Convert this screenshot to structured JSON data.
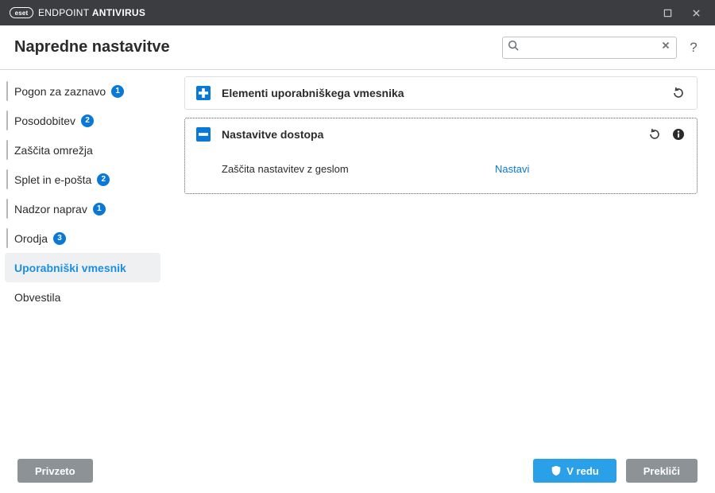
{
  "titlebar": {
    "brand_logo_text": "eset",
    "title_light": "ENDPOINT ",
    "title_bold": "ANTIVIRUS"
  },
  "header": {
    "page_title": "Napredne nastavitve",
    "search_placeholder": "",
    "help_label": "?"
  },
  "sidebar": {
    "items": [
      {
        "label": "Pogon za zaznavo",
        "badge": "1",
        "bar": true
      },
      {
        "label": "Posodobitev",
        "badge": "2",
        "bar": true
      },
      {
        "label": "Zaščita omrežja",
        "badge": "",
        "bar": true
      },
      {
        "label": "Splet in e-pošta",
        "badge": "2",
        "bar": true
      },
      {
        "label": "Nadzor naprav",
        "badge": "1",
        "bar": true
      },
      {
        "label": "Orodja",
        "badge": "3",
        "bar": true
      },
      {
        "label": "Uporabniški vmesnik",
        "badge": "",
        "bar": false,
        "selected": true
      },
      {
        "label": "Obvestila",
        "badge": "",
        "bar": false
      }
    ]
  },
  "main": {
    "panel_ui_elements": {
      "title": "Elementi uporabniškega vmesnika"
    },
    "panel_access": {
      "title": "Nastavitve dostopa",
      "row_password_label": "Zaščita nastavitev z geslom",
      "row_password_action": "Nastavi"
    }
  },
  "footer": {
    "default_label": "Privzeto",
    "ok_label": "V redu",
    "cancel_label": "Prekliči"
  }
}
